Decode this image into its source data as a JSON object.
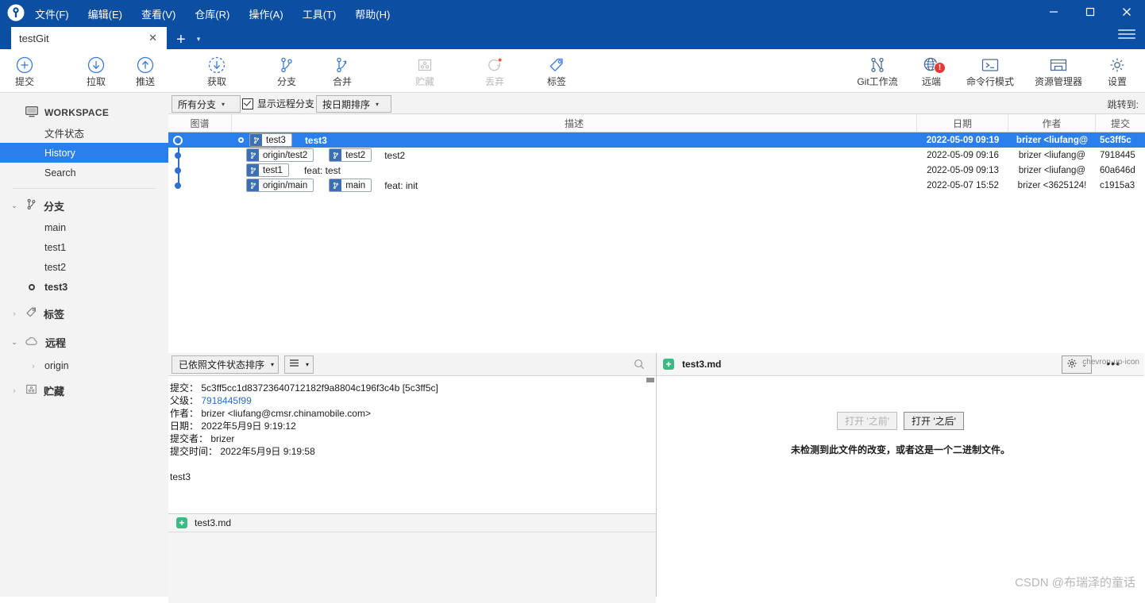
{
  "window": {
    "logo_icon": "sourcetree-logo-icon",
    "menus": [
      "文件(F)",
      "编辑(E)",
      "查看(V)",
      "仓库(R)",
      "操作(A)",
      "工具(T)",
      "帮助(H)"
    ],
    "minimize": "—",
    "maximize": "☐",
    "close": "✕",
    "accent": "#0b4ea2"
  },
  "tabs": {
    "items": [
      {
        "label": "testGit",
        "close": "✕"
      }
    ],
    "add": "+",
    "caret": "▾"
  },
  "toolbar": {
    "left": [
      {
        "label": "提交",
        "icon": "commit-plus-icon",
        "disabled": false
      },
      {
        "label": "拉取",
        "icon": "pull-down-arrow-icon",
        "disabled": false
      },
      {
        "label": "推送",
        "icon": "push-up-arrow-icon",
        "disabled": false
      },
      {
        "label": "获取",
        "icon": "fetch-dashed-arrow-icon",
        "disabled": false
      },
      {
        "label": "分支",
        "icon": "branch-icon",
        "disabled": false
      },
      {
        "label": "合并",
        "icon": "merge-icon",
        "disabled": false
      },
      {
        "label": "贮藏",
        "icon": "stash-icon",
        "disabled": true
      },
      {
        "label": "丢弃",
        "icon": "discard-refresh-icon",
        "disabled": true
      },
      {
        "label": "标签",
        "icon": "tag-icon",
        "disabled": false
      }
    ],
    "right": [
      {
        "label": "Git工作流",
        "icon": "git-flow-icon",
        "badge": ""
      },
      {
        "label": "远端",
        "icon": "remote-globe-icon",
        "badge": "!"
      },
      {
        "label": "命令行模式",
        "icon": "terminal-icon",
        "badge": ""
      },
      {
        "label": "资源管理器",
        "icon": "explorer-folder-icon",
        "badge": ""
      },
      {
        "label": "设置",
        "icon": "gear-icon",
        "badge": ""
      }
    ]
  },
  "sidebar": {
    "workspace": {
      "label": "WORKSPACE",
      "icon": "monitor-icon"
    },
    "workspace_items": [
      {
        "label": "文件状态",
        "selected": false
      },
      {
        "label": "History",
        "selected": true
      },
      {
        "label": "Search",
        "selected": false
      }
    ],
    "groups": [
      {
        "label": "分支",
        "icon": "branch-icon",
        "expanded": true,
        "chevron": "⌄",
        "branches": [
          {
            "label": "main",
            "current": false
          },
          {
            "label": "test1",
            "current": false
          },
          {
            "label": "test2",
            "current": false
          },
          {
            "label": "test3",
            "current": true
          }
        ]
      },
      {
        "label": "标签",
        "icon": "tag-icon",
        "expanded": false,
        "chevron": "›",
        "branches": []
      },
      {
        "label": "远程",
        "icon": "cloud-icon",
        "expanded": true,
        "chevron": "⌄",
        "subitems": [
          {
            "label": "origin",
            "chevron": "›"
          }
        ]
      },
      {
        "label": "贮藏",
        "icon": "stash-icon",
        "expanded": false,
        "chevron": "›",
        "branches": []
      }
    ]
  },
  "history": {
    "branch_filter": "所有分支",
    "show_remote_label": "显示远程分支",
    "show_remote_checked": true,
    "sort_order": "按日期排序",
    "jump_to_label": "跳转到:",
    "columns": [
      "图谱",
      "描述",
      "日期",
      "作者",
      "提交"
    ],
    "rows": [
      {
        "selected": true,
        "head": true,
        "refs": [
          "test3"
        ],
        "message": "test3",
        "date": "2022-05-09 09:19",
        "author": "brizer <liufang@",
        "sha": "5c3ff5c"
      },
      {
        "selected": false,
        "head": false,
        "refs": [
          "origin/test2",
          "test2"
        ],
        "message": "test2",
        "date": "2022-05-09 09:16",
        "author": "brizer <liufang@",
        "sha": "7918445"
      },
      {
        "selected": false,
        "head": false,
        "refs": [
          "test1"
        ],
        "message": "feat: test",
        "date": "2022-05-09 09:13",
        "author": "brizer <liufang@",
        "sha": "60a646d"
      },
      {
        "selected": false,
        "head": false,
        "refs": [
          "origin/main",
          "main"
        ],
        "message": "feat: init",
        "date": "2022-05-07 15:52",
        "author": "brizer <3625124!",
        "sha": "c1915a3"
      }
    ]
  },
  "commit_detail": {
    "sort_combo": "已依照文件状态排序",
    "view_icon": "list-view-icon",
    "search_icon": "search-icon",
    "fields": {
      "commit_label": "提交：",
      "commit_value": "5c3ff5cc1d83723640712182f9a8804c196f3c4b [5c3ff5c]",
      "parent_label": "父级：",
      "parent_value": "7918445f99",
      "author_label": "作者：",
      "author_value": "brizer <liufang@cmsr.chinamobile.com>",
      "date_label": "日期：",
      "date_value": "2022年5月9日 9:19:12",
      "committer_label": "提交者：",
      "committer_value": "brizer",
      "commit_time_label": "提交时间：",
      "commit_time_value": "2022年5月9日 9:19:58"
    },
    "message": "test3",
    "file": {
      "name": "test3.md",
      "status_icon": "add-file-icon",
      "status": "+"
    }
  },
  "diff": {
    "file_name": "test3.md",
    "status_icon": "add-file-icon",
    "status": "+",
    "gear_icon": "gear-icon",
    "gear_caret": "⌄",
    "more_icon": "ellipsis-icon",
    "collapse_icon": "chevron-up-icon",
    "open_before": "打开 '之前'",
    "open_after": "打开 '之后'",
    "no_change_text": "未检测到此文件的改变，或者这是一个二进制文件。"
  },
  "watermark": "CSDN @布瑞泽的童话"
}
